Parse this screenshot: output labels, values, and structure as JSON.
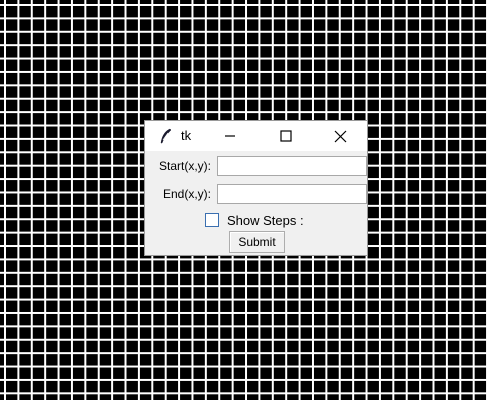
{
  "window": {
    "title": "tk",
    "controls": {
      "minimize_icon": "minimize-icon",
      "maximize_icon": "maximize-icon",
      "close_icon": "close-icon"
    }
  },
  "form": {
    "start_label": "Start(x,y):",
    "start_value": "",
    "end_label": "End(x,y):",
    "end_value": "",
    "show_steps_label": "Show Steps :",
    "show_steps_checked": false,
    "submit_label": "Submit"
  },
  "colors": {
    "background_grid_bg": "#000000",
    "background_grid_lines": "#ffffff",
    "window_bg": "#f0f0f0",
    "checkbox_border": "#3a6fb0"
  }
}
